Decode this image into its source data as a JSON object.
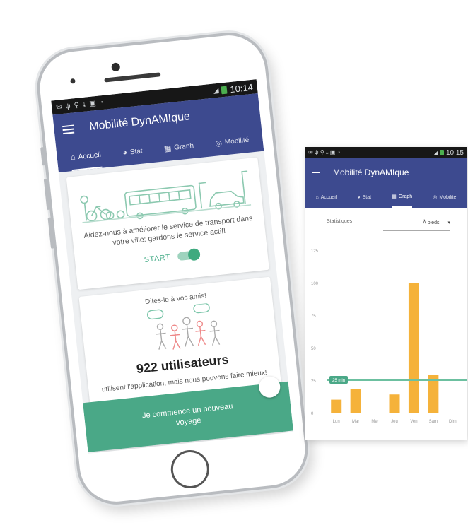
{
  "main_phone": {
    "status_bar": {
      "time": "10:14"
    },
    "app_title": "Mobilité DynAMIque",
    "tabs": [
      {
        "label": "Accueil",
        "icon": "home-icon",
        "active": true
      },
      {
        "label": "Stat",
        "icon": "pie-chart-icon",
        "active": false
      },
      {
        "label": "Graph",
        "icon": "bar-chart-icon",
        "active": false
      },
      {
        "label": "Mobilité",
        "icon": "mobility-icon",
        "active": false
      }
    ],
    "card1": {
      "text": "Aidez-nous à améliorer le service de transport dans votre ville: gardons le service actif!",
      "start_label": "START"
    },
    "card2": {
      "share_text": "Dites-le à vos amis!",
      "count": "922 utilisateurs",
      "description": "utilisent l'application, mais nous pouvons faire mieux!"
    },
    "cta_button": "Je commence un nouveau voyage"
  },
  "second_screen": {
    "status_bar": {
      "time": "10:15"
    },
    "app_title": "Mobilité DynAMIque",
    "tabs": [
      {
        "label": "Accueil",
        "icon": "home-icon",
        "active": false
      },
      {
        "label": "Stat",
        "icon": "pie-chart-icon",
        "active": false
      },
      {
        "label": "Graph",
        "icon": "bar-chart-icon",
        "active": true
      },
      {
        "label": "Mobilité",
        "icon": "mobility-icon",
        "active": false
      }
    ],
    "stat_label": "Statistiques",
    "select_value": "À pieds",
    "average_label": "25 min"
  },
  "colors": {
    "primary": "#3d4a8f",
    "accent_green": "#4aa887",
    "bar_orange": "#f5b23a",
    "avg_line": "#6cc0a0"
  },
  "chart_data": {
    "type": "bar",
    "categories": [
      "Lun",
      "Mar",
      "Mer",
      "Jeu",
      "Ven",
      "Sam",
      "Dim"
    ],
    "values": [
      10,
      18,
      0,
      14,
      100,
      29,
      0
    ],
    "ylim": [
      0,
      125
    ],
    "yticks": [
      0,
      25,
      50,
      75,
      100,
      125
    ],
    "reference_line": 25,
    "grid": false
  }
}
